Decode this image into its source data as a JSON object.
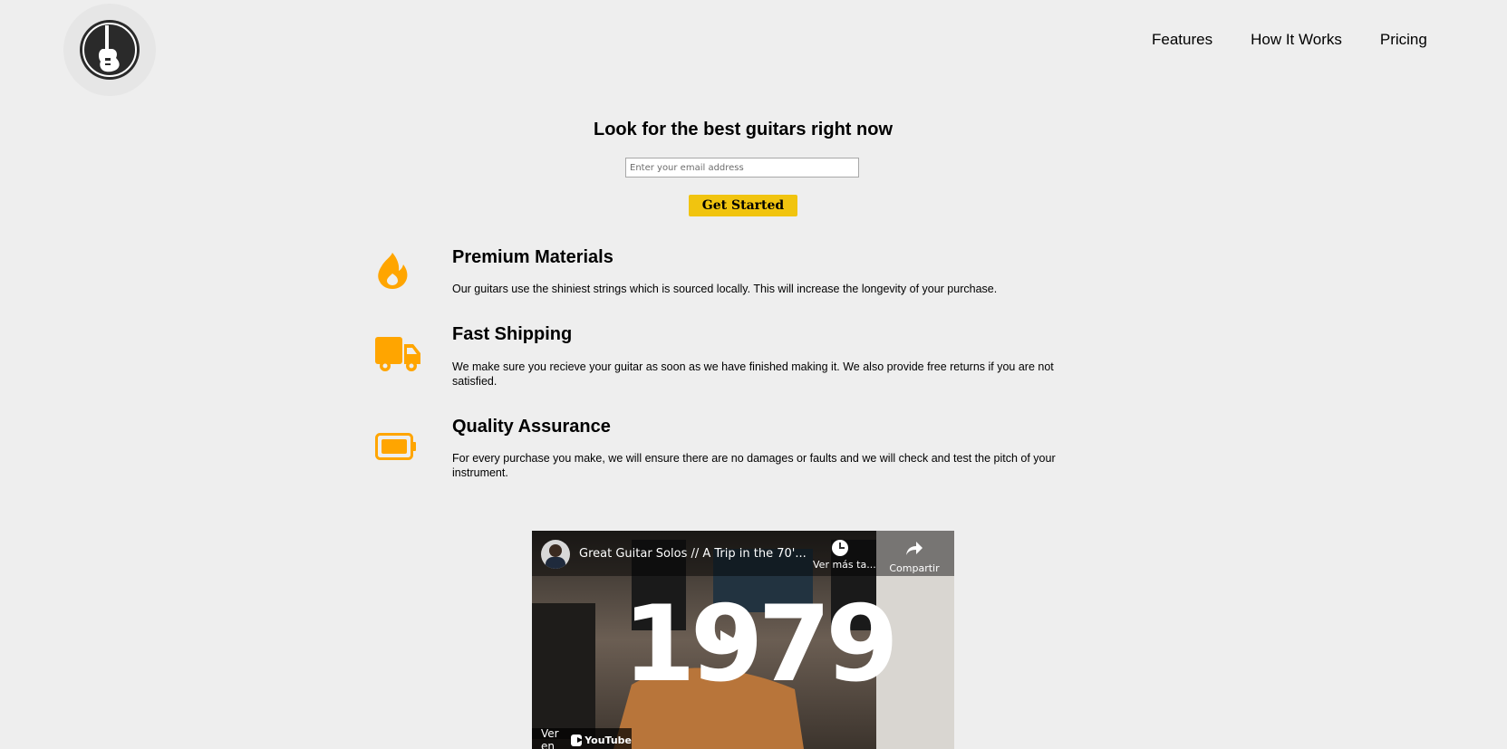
{
  "nav": {
    "items": [
      {
        "label": "Features"
      },
      {
        "label": "How It Works"
      },
      {
        "label": "Pricing"
      }
    ]
  },
  "hero": {
    "title": "Look for the best guitars right now",
    "email_placeholder": "Enter your email address",
    "cta_label": "Get Started"
  },
  "features": [
    {
      "icon": "fire-icon",
      "title": "Premium Materials",
      "text": "Our guitars use the shiniest strings which is sourced locally. This will increase the longevity of your purchase."
    },
    {
      "icon": "truck-icon",
      "title": "Fast Shipping",
      "text": "We make sure you recieve your guitar as soon as we have finished making it. We also provide free returns if you are not satisfied."
    },
    {
      "icon": "battery-icon",
      "title": "Quality Assurance",
      "text": "For every purchase you make, we will ensure there are no damages or faults and we will check and test the pitch of your instrument."
    }
  ],
  "video": {
    "title": "Great Guitar Solos // A Trip in the 70'...",
    "watch_later": "Ver más ta...",
    "share": "Compartir",
    "overlay_text": "1979",
    "watch_on": "Ver en",
    "youtube": "YouTube"
  },
  "colors": {
    "accent": "#f1c40f",
    "icon": "#ffa500",
    "background": "#eeeeee"
  }
}
